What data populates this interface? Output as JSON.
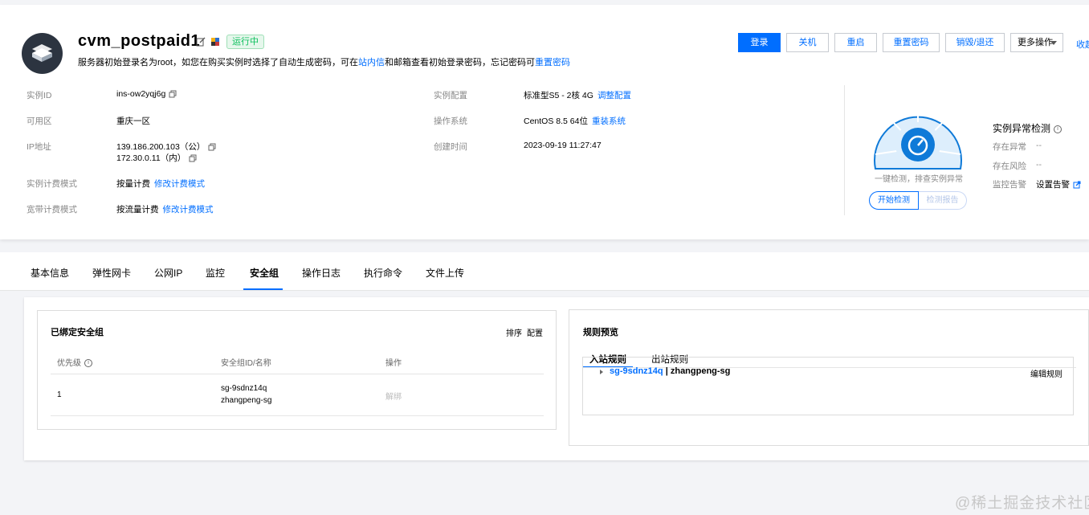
{
  "header": {
    "title": "cvm_postpaid1",
    "status": "运行中",
    "hint_prefix": "服务器初始登录名为root，如您在购买实例时选择了自动生成密码，可在",
    "hint_link1": "站内信",
    "hint_middle": "和邮箱查看初始登录密码，忘记密码可",
    "hint_link2": "重置密码"
  },
  "toolbar": {
    "login": "登录",
    "shutdown": "关机",
    "restart": "重启",
    "reset_password": "重置密码",
    "destroy": "销毁/退还",
    "more": "更多操作",
    "collapse": "收起"
  },
  "info": {
    "instance_id_label": "实例ID",
    "instance_id": "ins-ow2yqj6g",
    "zone_label": "可用区",
    "zone": "重庆一区",
    "ip_label": "IP地址",
    "ip_public": "139.186.200.103（公）",
    "ip_private": "172.30.0.11（内）",
    "billing_label": "实例计费模式",
    "billing": "按量计费",
    "billing_link": "修改计费模式",
    "bandwidth_label": "宽带计费模式",
    "bandwidth": "按流量计费",
    "bandwidth_link": "修改计费模式",
    "config_label": "实例配置",
    "config": "标准型S5 - 2核 4G",
    "config_link": "调整配置",
    "os_label": "操作系统",
    "os": "CentOS 8.5 64位",
    "os_link": "重装系统",
    "created_label": "创建时间",
    "created": "2023-09-19 11:27:47"
  },
  "detect": {
    "caption": "一键检测，排查实例异常",
    "start": "开始检测",
    "report": "检测报告",
    "title": "实例异常检测",
    "anomaly_label": "存在异常",
    "anomaly_value": "--",
    "risk_label": "存在风险",
    "risk_value": "--",
    "alarm_label": "监控告警",
    "alarm_link": "设置告警"
  },
  "tabs": [
    "基本信息",
    "弹性网卡",
    "公网IP",
    "监控",
    "安全组",
    "操作日志",
    "执行命令",
    "文件上传"
  ],
  "bound_sg": {
    "title": "已绑定安全组",
    "sort": "排序",
    "configure": "配置",
    "columns": [
      "优先级",
      "安全组ID/名称",
      "操作"
    ],
    "rows": [
      {
        "priority": "1",
        "sg_id": "sg-9sdnz14q",
        "sg_name": "zhangpeng-sg",
        "action": "解绑"
      }
    ]
  },
  "rules_preview": {
    "title": "规则预览",
    "inbound": "入站规则",
    "outbound": "出站规则",
    "rule_sg_id": "sg-9sdnz14q",
    "rule_sep": " | ",
    "rule_sg_name": "zhangpeng-sg",
    "edit": "编辑规则"
  },
  "watermark": "@稀土掘金技术社区",
  "colors": {
    "accent": "#006eff",
    "running": "#0abf5b",
    "gauge": "#ddeefc"
  }
}
